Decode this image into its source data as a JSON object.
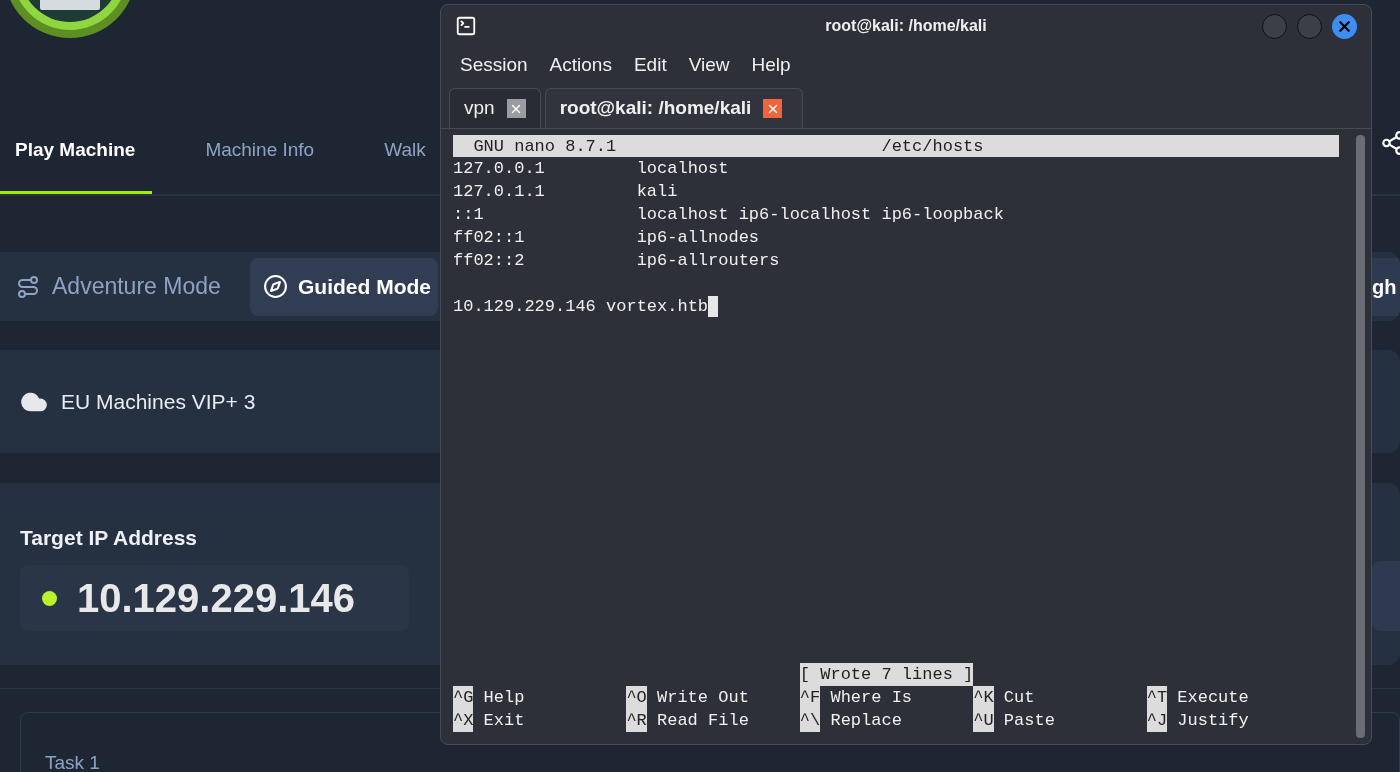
{
  "page": {
    "tabs": [
      {
        "label": "Play Machine",
        "selected": true
      },
      {
        "label": "Machine Info",
        "selected": false
      },
      {
        "label": "Walk",
        "selected": false
      }
    ],
    "modes": [
      {
        "label": "Adventure Mode",
        "selected": false,
        "kind": "route"
      },
      {
        "label": "Guided Mode",
        "selected": true,
        "kind": "compass"
      }
    ],
    "video_button_fragment": "gh",
    "vpn": {
      "server": "EU Machines VIP+ 3"
    },
    "target": {
      "heading": "Target IP Address",
      "ip": "10.129.229.146",
      "active": true
    },
    "task": {
      "title": "Task 1"
    }
  },
  "terminal": {
    "title": "root@kali: /home/kali",
    "menu": [
      "Session",
      "Actions",
      "Edit",
      "View",
      "Help"
    ],
    "tabs": [
      {
        "label": "vpn",
        "selected": false
      },
      {
        "label": "root@kali: /home/kali",
        "selected": true
      }
    ],
    "editor": {
      "app": "GNU nano 8.7.1",
      "file": "/etc/hosts",
      "lines": [
        {
          "kind": "entry",
          "address": "127.0.0.1",
          "names": "localhost"
        },
        {
          "kind": "entry",
          "address": "127.0.1.1",
          "names": "kali"
        },
        {
          "kind": "entry",
          "address": "::1",
          "names": "localhost ip6-localhost ip6-loopback"
        },
        {
          "kind": "entry",
          "address": "ff02::1",
          "names": "ip6-allnodes"
        },
        {
          "kind": "entry",
          "address": "ff02::2",
          "names": "ip6-allrouters"
        },
        {
          "kind": "blank"
        },
        {
          "kind": "text",
          "text": "10.129.229.146 vortex.htb",
          "cursor": true
        }
      ],
      "status": "[ Wrote 7 lines ]",
      "shortcut_rows": [
        [
          {
            "key": "^G",
            "label": "Help"
          },
          {
            "key": "^O",
            "label": "Write Out"
          },
          {
            "key": "^F",
            "label": "Where Is"
          },
          {
            "key": "^K",
            "label": "Cut"
          },
          {
            "key": "^T",
            "label": "Execute"
          }
        ],
        [
          {
            "key": "^X",
            "label": "Exit"
          },
          {
            "key": "^R",
            "label": "Read File"
          },
          {
            "key": "^\\",
            "label": "Replace"
          },
          {
            "key": "^U",
            "label": "Paste"
          },
          {
            "key": "^J",
            "label": "Justify"
          }
        ]
      ]
    }
  }
}
